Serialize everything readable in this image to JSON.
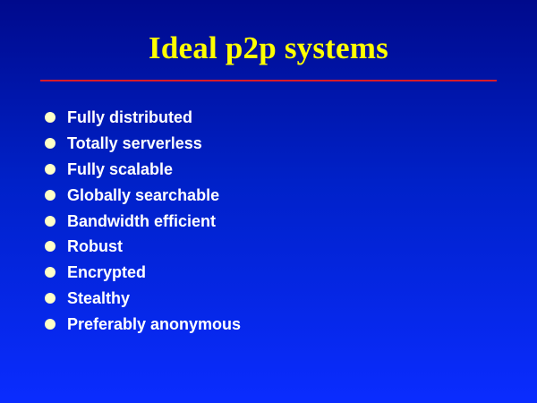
{
  "slide": {
    "title": "Ideal p2p systems",
    "bullets": [
      "Fully distributed",
      "Totally serverless",
      "Fully scalable",
      "Globally searchable",
      "Bandwidth efficient",
      "Robust",
      "Encrypted",
      "Stealthy",
      "Preferably anonymous"
    ]
  },
  "colors": {
    "background_top": "#000a8c",
    "background_bottom": "#0a2cff",
    "title": "#ffff00",
    "divider": "#d81b2a",
    "bullet_text": "#ffffff",
    "bullet_marker": "#ffffc8"
  },
  "icons": {
    "bullet_marker": "bullet-dot-icon"
  }
}
